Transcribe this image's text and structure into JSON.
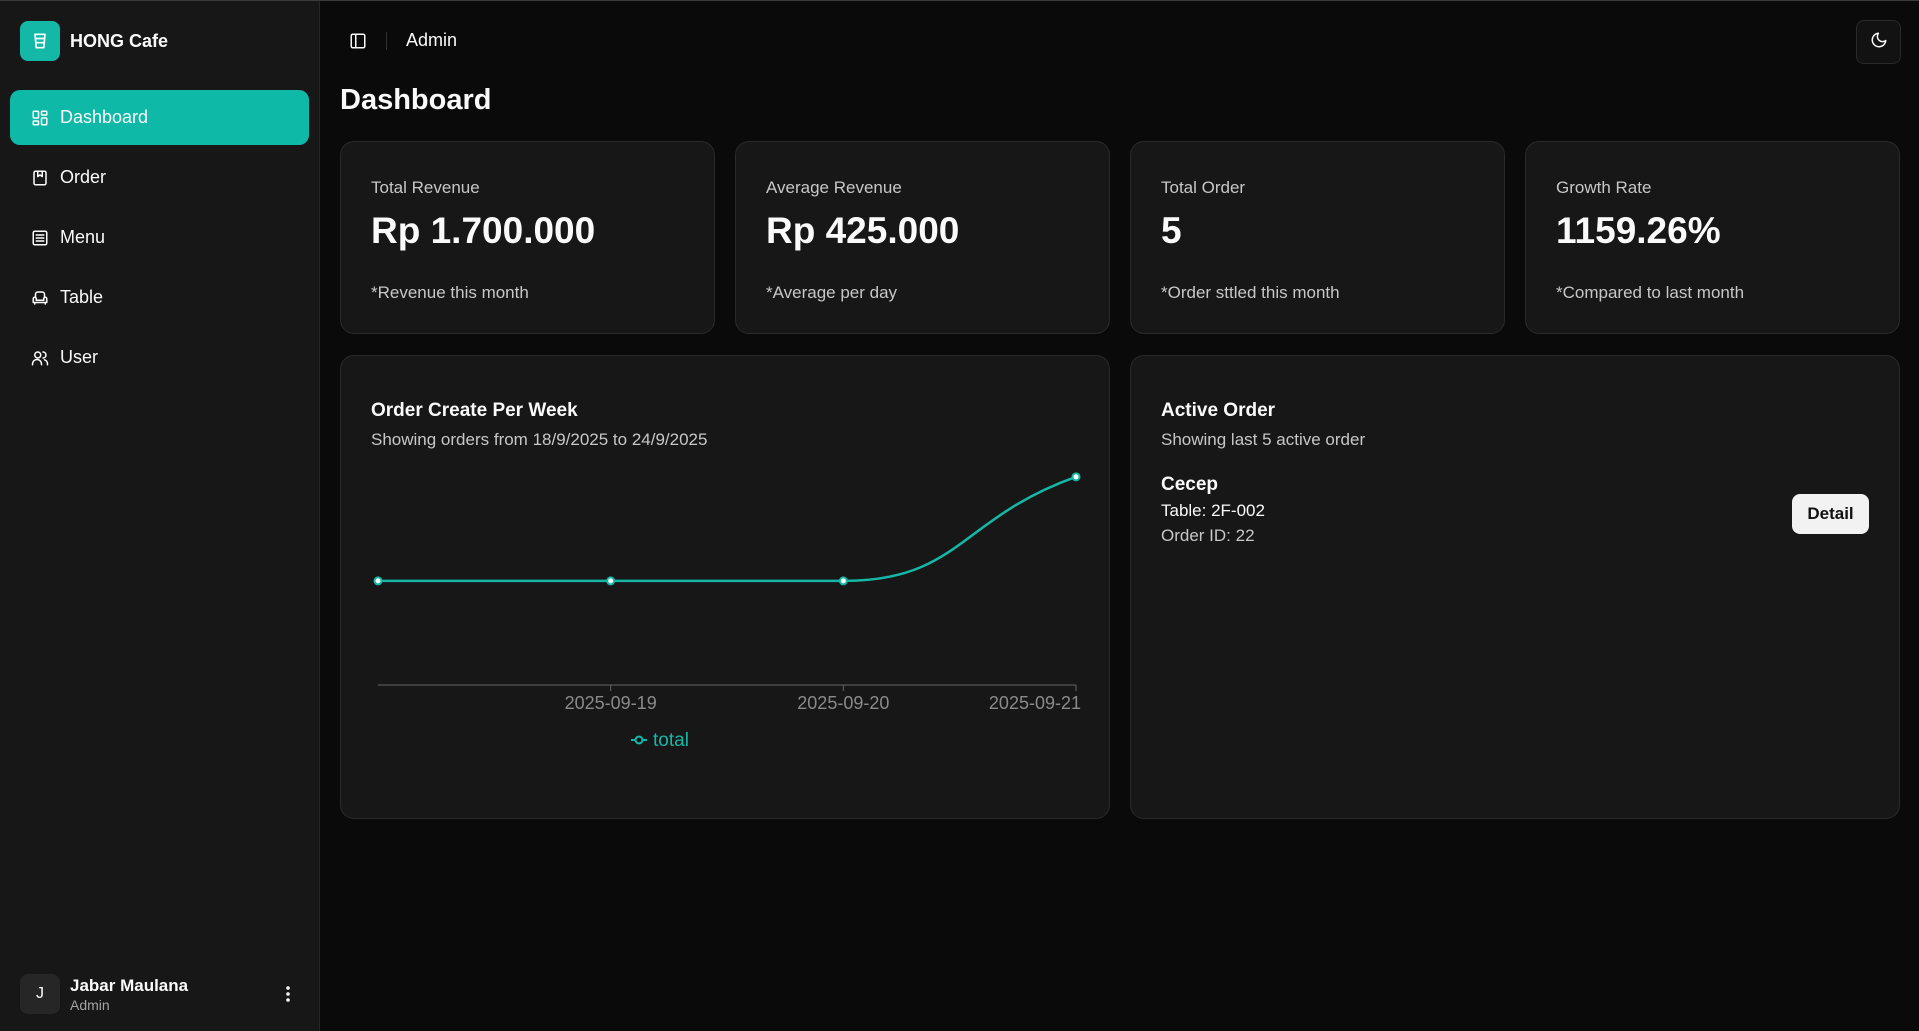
{
  "brand": {
    "name": "HONG Cafe",
    "logo_icon": "cup-icon"
  },
  "sidebar": {
    "items": [
      {
        "label": "Dashboard",
        "icon": "dashboard-icon",
        "active": true
      },
      {
        "label": "Order",
        "icon": "bookmark-icon",
        "active": false
      },
      {
        "label": "Menu",
        "icon": "list-icon",
        "active": false
      },
      {
        "label": "Table",
        "icon": "armchair-icon",
        "active": false
      },
      {
        "label": "User",
        "icon": "users-icon",
        "active": false
      }
    ],
    "user": {
      "initial": "J",
      "name": "Jabar Maulana",
      "role": "Admin"
    }
  },
  "header": {
    "title": "Admin"
  },
  "page": {
    "title": "Dashboard"
  },
  "stats": [
    {
      "label": "Total Revenue",
      "value": "Rp 1.700.000",
      "note": "*Revenue this month"
    },
    {
      "label": "Average Revenue",
      "value": "Rp 425.000",
      "note": "*Average per day"
    },
    {
      "label": "Total Order",
      "value": "5",
      "note": "*Order sttled this month"
    },
    {
      "label": "Growth Rate",
      "value": "1159.26%",
      "note": "*Compared to last month"
    }
  ],
  "chart_panel": {
    "title": "Order Create Per Week",
    "subtitle": "Showing orders from 18/9/2025 to 24/9/2025"
  },
  "chart_data": {
    "type": "line",
    "x": [
      "",
      "2025-09-19",
      "2025-09-20",
      "2025-09-21"
    ],
    "series": [
      {
        "name": "total",
        "values": [
          1,
          1,
          1,
          2
        ]
      }
    ],
    "ylim": [
      0,
      2.2
    ],
    "legend": "bottom-center",
    "grid": false
  },
  "active_orders": {
    "title": "Active Order",
    "subtitle": "Showing last 5 active order",
    "orders": [
      {
        "name": "Cecep",
        "table": "Table: 2F-002",
        "order_id": "Order ID: 22",
        "button": "Detail"
      }
    ]
  },
  "colors": {
    "accent": "#14b8a6",
    "background": "#0a0a0a",
    "card": "#171717"
  }
}
